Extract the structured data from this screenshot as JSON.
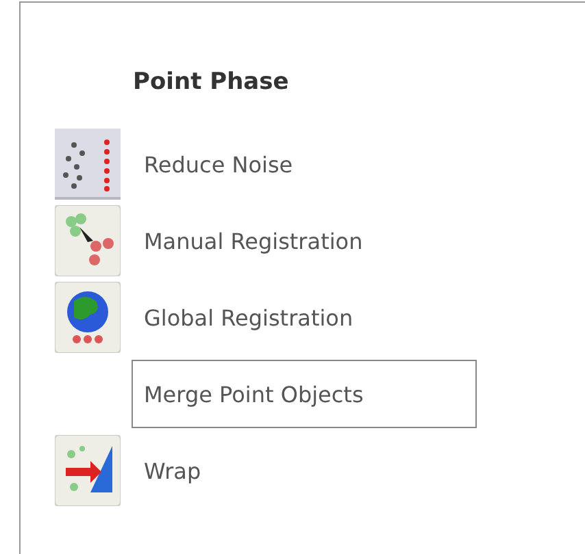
{
  "panel": {
    "heading": "Point Phase",
    "items": [
      {
        "label": "Reduce Noise",
        "kind": "noise",
        "selected": false
      },
      {
        "label": "Manual Registration",
        "kind": "manual",
        "selected": false
      },
      {
        "label": "Global Registration",
        "kind": "globe",
        "selected": false
      },
      {
        "label": "Merge Point Objects",
        "kind": "plain",
        "selected": true
      },
      {
        "label": "Wrap",
        "kind": "wrap",
        "selected": false
      }
    ]
  }
}
